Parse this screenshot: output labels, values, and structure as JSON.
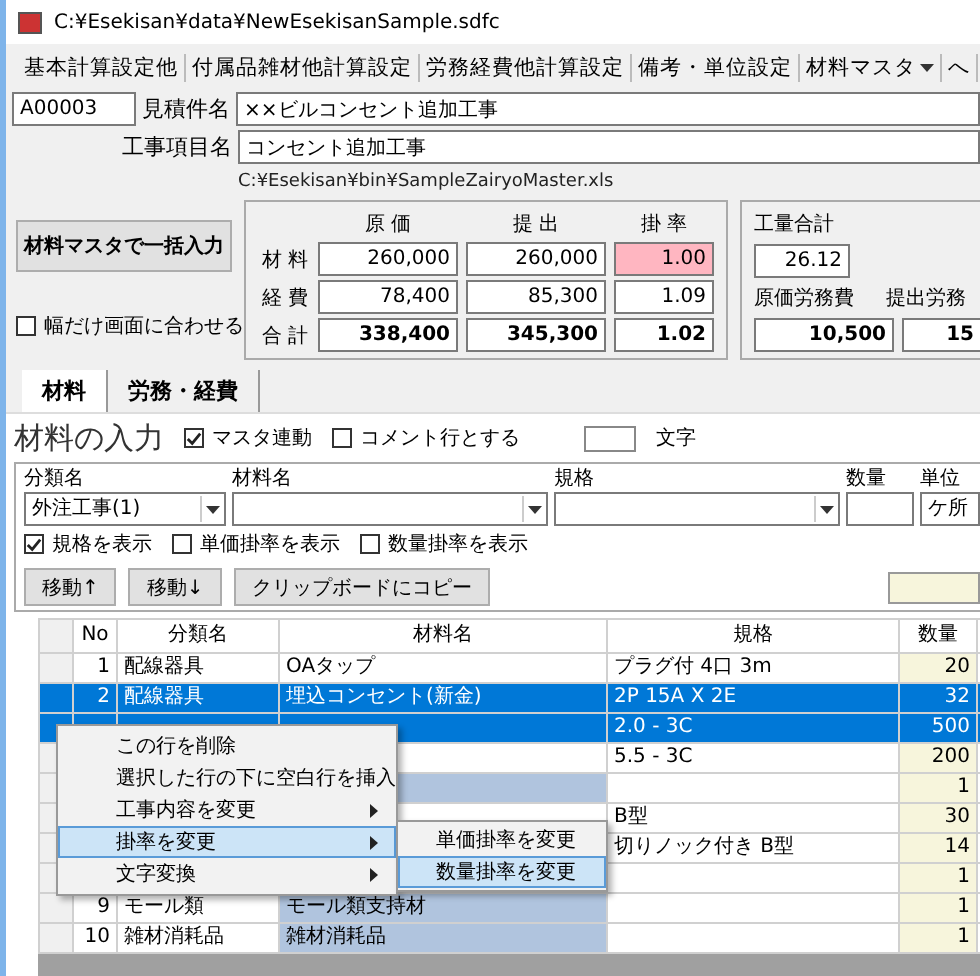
{
  "window": {
    "title": "C:¥Esekisan¥data¥NewEsekisanSample.sdfc"
  },
  "menu": [
    {
      "label": "基本計算設定他",
      "dropdown": false
    },
    {
      "label": "付属品雑材他計算設定",
      "dropdown": false
    },
    {
      "label": "労務経費他計算設定",
      "dropdown": false
    },
    {
      "label": "備考・単位設定",
      "dropdown": false
    },
    {
      "label": "材料マスタ",
      "dropdown": true
    },
    {
      "label": "へ"
    }
  ],
  "header": {
    "code": "A00003",
    "estimate_label": "見積件名",
    "estimate_value": "××ビルコンセント追加工事",
    "item_label": "工事項目名",
    "item_value": "コンセント追加工事",
    "master_path": "C:¥Esekisan¥bin¥SampleZairyoMaster.xls"
  },
  "bulk_button": "材料マスタで一括入力",
  "fit_width": {
    "label": "幅だけ画面に合わせる",
    "checked": false
  },
  "costs": {
    "columns": [
      "原 価",
      "提 出",
      "掛 率"
    ],
    "rows": [
      {
        "label": "材 料",
        "values": [
          "260,000",
          "260,000",
          "1.00"
        ],
        "highlight": true,
        "bold": false
      },
      {
        "label": "経 費",
        "values": [
          "78,400",
          "85,300",
          "1.09"
        ],
        "highlight": false,
        "bold": false
      },
      {
        "label": "合 計",
        "values": [
          "338,400",
          "345,300",
          "1.02"
        ],
        "highlight": false,
        "bold": true
      }
    ]
  },
  "labor": {
    "total_label": "工量合計",
    "total_value": "26.12",
    "cost_label": "原価労務費",
    "cost_value": "10,500",
    "submit_label": "提出労務",
    "submit_value": "15"
  },
  "tabs": [
    {
      "label": "材料",
      "selected": true
    },
    {
      "label": "労務・経費",
      "selected": false
    }
  ],
  "input": {
    "title": "材料の入力",
    "options": [
      {
        "label": "マスタ連動",
        "checked": true
      },
      {
        "label": "コメント行とする",
        "checked": false
      }
    ],
    "text_label": "文字",
    "fields": [
      {
        "label": "分類名",
        "value": "外注工事(1)",
        "kind": "combo"
      },
      {
        "label": "材料名",
        "kind": "combo"
      },
      {
        "label": "規格",
        "kind": "combo"
      },
      {
        "label": "数量",
        "kind": "text"
      },
      {
        "label": "単位",
        "value": "ケ所",
        "kind": "text"
      }
    ],
    "show_options": [
      {
        "label": "規格を表示",
        "checked": true
      },
      {
        "label": "単価掛率を表示",
        "checked": false
      },
      {
        "label": "数量掛率を表示",
        "checked": false
      }
    ],
    "buttons": [
      "移動↑",
      "移動↓",
      "クリップボードにコピー"
    ]
  },
  "table": {
    "columns": [
      "No",
      "分類名",
      "材料名",
      "規格",
      "数量"
    ],
    "rows": [
      {
        "cells": [
          "1",
          "配線器具",
          "OAタップ",
          "プラグ付 4口 3m",
          "20"
        ],
        "selected": false,
        "shaded": false
      },
      {
        "cells": [
          "2",
          "配線器具",
          "埋込コンセント(新金)",
          "2P 15A X 2E",
          "32"
        ],
        "selected": true,
        "shaded": false
      },
      {
        "cells": [
          "",
          "",
          "",
          "2.0 - 3C",
          "500"
        ],
        "selected": true
      },
      {
        "cells": [
          "",
          "",
          "",
          "5.5 - 3C",
          "200"
        ],
        "selected": false
      },
      {
        "cells": [
          "",
          "",
          "",
          "",
          "1"
        ],
        "selected": false,
        "shaded": true
      },
      {
        "cells": [
          "",
          "",
          "",
          "B型",
          "30"
        ],
        "selected": false
      },
      {
        "cells": [
          "",
          "",
          "",
          "切りノック付き B型",
          "14"
        ],
        "selected": false
      },
      {
        "cells": [
          "",
          "",
          "",
          "",
          "1"
        ],
        "selected": false
      },
      {
        "cells": [
          "9",
          "モール類",
          "モール類支持材",
          "",
          "1"
        ],
        "selected": false,
        "shaded": true
      },
      {
        "cells": [
          "10",
          "雑材消耗品",
          "雑材消耗品",
          "",
          "1"
        ],
        "selected": false,
        "shaded": true
      }
    ]
  },
  "context_menu": {
    "items": [
      {
        "label": "この行を削除",
        "selected": false
      },
      {
        "label": "選択した行の下に空白行を挿入",
        "selected": false
      },
      {
        "label": "工事内容を変更",
        "submenu": true,
        "selected": false
      },
      {
        "label": "掛率を変更",
        "submenu": true,
        "selected": true
      },
      {
        "label": "文字変換",
        "submenu": true,
        "selected": false
      }
    ],
    "submenu": [
      {
        "label": "単価掛率を変更",
        "selected": false
      },
      {
        "label": "数量掛率を変更",
        "selected": true
      }
    ]
  }
}
